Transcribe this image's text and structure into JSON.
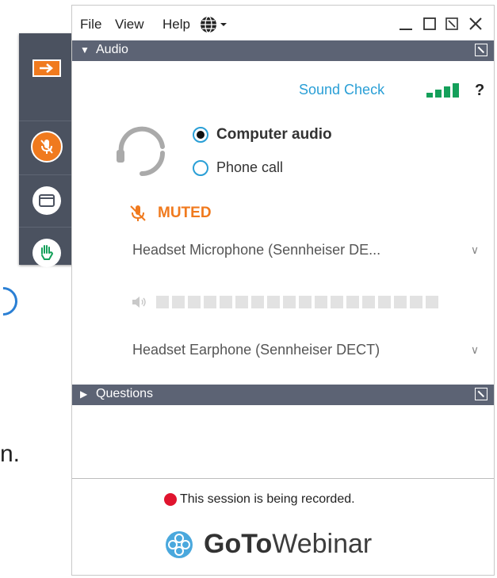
{
  "background": {
    "fragment_text": "n."
  },
  "toolbar": {
    "items": [
      {
        "icon": "arrow-right-icon"
      },
      {
        "icon": "microphone-muted-icon"
      },
      {
        "icon": "screen-icon"
      },
      {
        "icon": "raise-hand-icon"
      }
    ],
    "accent_color": "#f07a1e"
  },
  "menubar": {
    "file": "File",
    "view": "View",
    "help": "Help"
  },
  "audio": {
    "section_title": "Audio",
    "sound_check": "Sound Check",
    "help_mark": "?",
    "options": {
      "computer_audio": "Computer audio",
      "phone_call": "Phone call",
      "selected": "computer_audio"
    },
    "mute_status": "MUTED",
    "microphone_device": "Headset Microphone (Sennheiser DE...",
    "speaker_device": "Headset Earphone (Sennheiser DECT)"
  },
  "questions": {
    "section_title": "Questions"
  },
  "footer": {
    "recording_notice": "This session is being recorded.",
    "brand_bold": "GoTo",
    "brand_regular": "Webinar"
  },
  "colors": {
    "header_bar": "#5c6374",
    "link_blue": "#2a9fd6",
    "muted_orange": "#f07a1e",
    "signal_green": "#14a05a",
    "record_red": "#e0142e"
  }
}
